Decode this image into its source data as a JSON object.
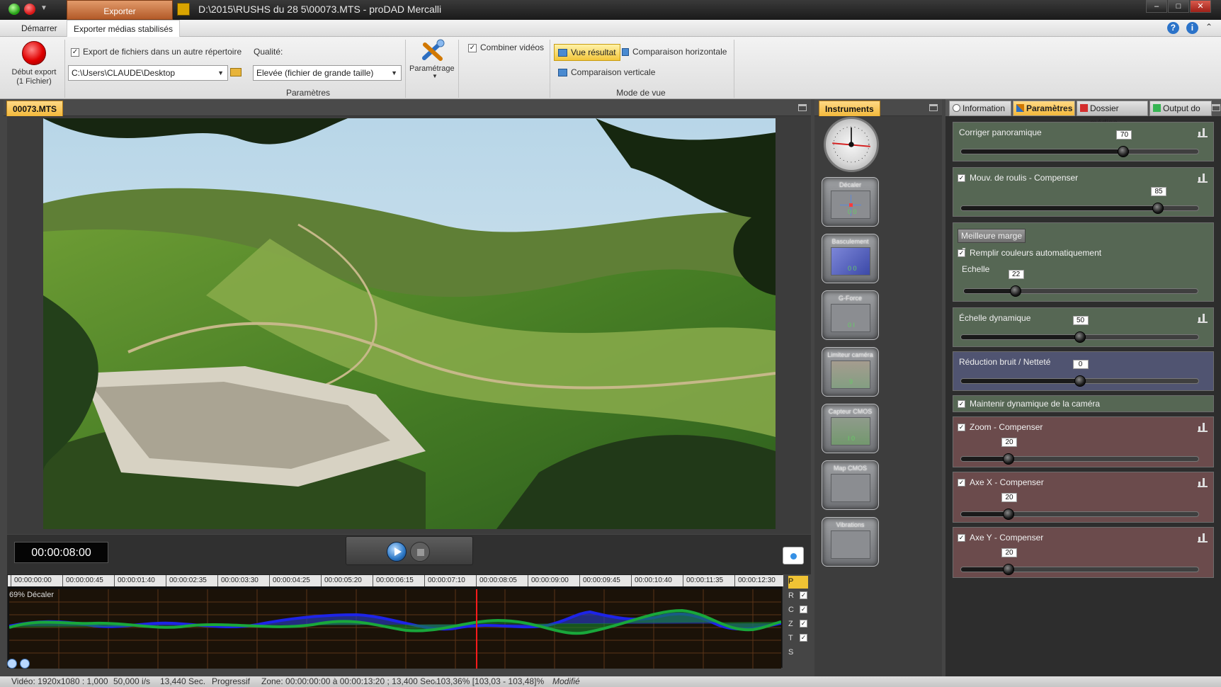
{
  "window": {
    "title": "D:\\2015\\RUSHS du 28 5\\00073.MTS - proDAD Mercalli",
    "tab": "Exporter",
    "minimize": "–",
    "maximize": "□",
    "close": "✕"
  },
  "menu": {
    "start": "Démarrer",
    "active": "Exporter médias stabilisés",
    "help": "?",
    "info": "i",
    "collapse": "⌃"
  },
  "ribbon": {
    "export_label_1": "Début export",
    "export_label_2": "(1 Fichier)",
    "export_to_dir": "Export de fichiers dans un autre répertoire",
    "export_to_dir_checked": "✓",
    "path_value": "C:\\Users\\CLAUDE\\Desktop",
    "quality_label": "Qualité:",
    "quality_value": "Elevée    (fichier de grande taille)",
    "settings_label": "Paramétrage",
    "params_group": "Paramètres",
    "combine": "Combiner vidéos",
    "combine_checked": "✓",
    "view_result": "Vue résultat",
    "compare_h": "Comparaison horizontale",
    "compare_v": "Comparaison verticale",
    "view_mode_group": "Mode de vue"
  },
  "preview": {
    "tab": "00073.MTS",
    "timecode": "00:00:08:00",
    "timeline_ticks": [
      "00:00:00:00",
      "00:00:00:45",
      "00:00:01:40",
      "00:00:02:35",
      "00:00:03:30",
      "00:00:04:25",
      "00:00:05:20",
      "00:00:06:15",
      "00:00:07:10",
      "00:00:08:05",
      "00:00:09:00",
      "00:00:09:45",
      "00:00:10:40",
      "00:00:11:35",
      "00:00:12:30"
    ],
    "graph_label": "69% Décaler",
    "side_labels": [
      "P",
      "R",
      "C",
      "Z",
      "T",
      "S"
    ],
    "side_checks": [
      "",
      "✓",
      "✓",
      "✓",
      "✓",
      ""
    ]
  },
  "instruments": {
    "tab": "Instruments",
    "items": [
      "Décaler",
      "Basculement",
      "G-Force",
      "Limiteur caméra",
      "Capteur CMOS",
      "Map CMOS",
      "Vibrations"
    ],
    "readouts": [
      "0    0",
      "0    0",
      "0  I",
      "9",
      "I    0"
    ]
  },
  "parameters": {
    "tabs": [
      "Information",
      "Paramètres",
      "Dossier médias",
      "Output do"
    ],
    "correct_panoramic": "Corriger panoramique",
    "correct_panoramic_value": 70,
    "roll": "Mouv. de roulis - Compenser",
    "roll_value": 85,
    "margin": "Meilleure marge",
    "fill_colors": "Remplir couleurs automatiquement",
    "scale": "Echelle",
    "scale_value": 22,
    "dynamic_scale": "Échelle dynamique",
    "dynamic_scale_value": 50,
    "noise": "Réduction bruit / Netteté",
    "noise_value": 0,
    "maintain_camera": "Maintenir dynamique de la caméra",
    "zoom": "Zoom - Compenser",
    "zoom_value": 20,
    "axis_x": "Axe X - Compenser",
    "axis_x_value": 20,
    "axis_y": "Axe Y - Compenser",
    "axis_y_value": 20,
    "check": "✓"
  },
  "status": {
    "video": "Vidéo: 1920x1080 : 1,000",
    "fps": "50,000 i/s",
    "duration": "13,440 Sec.",
    "scan": "Progressif",
    "zone": "Zone: 00:00:00:00 à 00:00:13:20 ; 13,400 Sec.",
    "scale": "-103,36% [103,03 - 103,48]%",
    "state": "Modifié"
  },
  "colors": {
    "accent": "#f3b93c",
    "blue_line": "#1d24e8",
    "green_line": "#19a73b",
    "playhead": "#ff1b1b"
  }
}
